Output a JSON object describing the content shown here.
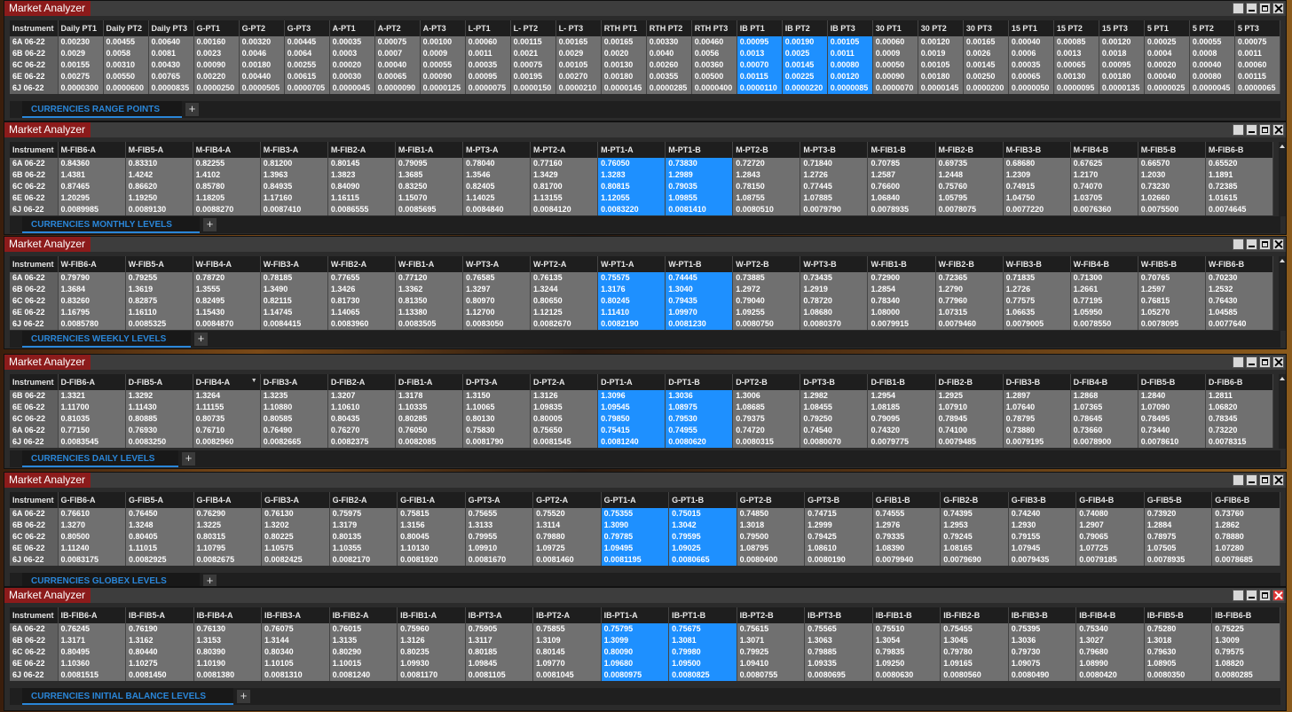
{
  "panels": [
    {
      "title": "Market Analyzer",
      "tab": "CURRENCIES RANGE POINTS",
      "plus": "+",
      "columns": [
        "Instrument",
        "Daily PT1",
        "Daily PT2",
        "Daily PT3",
        "G-PT1",
        "G-PT2",
        "G-PT3",
        "A-PT1",
        "A-PT2",
        "A-PT3",
        "L-PT1",
        "L- PT2",
        "L- PT3",
        "RTH PT1",
        "RTH PT2",
        "RTH PT3",
        "IB PT1",
        "IB PT2",
        "IB PT3",
        "30 PT1",
        "30 PT2",
        "30 PT3",
        "15 PT1",
        "15 PT2",
        "15 PT3",
        "5 PT1",
        "5 PT2",
        "5 PT3"
      ],
      "highlight": [
        16,
        17,
        18
      ],
      "rows": [
        [
          "6A 06-22",
          "0.00230",
          "0.00455",
          "0.00640",
          "0.00160",
          "0.00320",
          "0.00445",
          "0.00035",
          "0.00075",
          "0.00100",
          "0.00060",
          "0.00115",
          "0.00165",
          "0.00165",
          "0.00330",
          "0.00460",
          "0.00095",
          "0.00190",
          "0.00105",
          "0.00060",
          "0.00120",
          "0.00165",
          "0.00040",
          "0.00085",
          "0.00120",
          "0.00025",
          "0.00055",
          "0.00075"
        ],
        [
          "6B 06-22",
          "0.0029",
          "0.0058",
          "0.0081",
          "0.0023",
          "0.0046",
          "0.0064",
          "0.0003",
          "0.0007",
          "0.0009",
          "0.0011",
          "0.0021",
          "0.0029",
          "0.0020",
          "0.0040",
          "0.0056",
          "0.0013",
          "0.0025",
          "0.0011",
          "0.0009",
          "0.0019",
          "0.0026",
          "0.0006",
          "0.0013",
          "0.0018",
          "0.0004",
          "0.0008",
          "0.0011"
        ],
        [
          "6C 06-22",
          "0.00155",
          "0.00310",
          "0.00430",
          "0.00090",
          "0.00180",
          "0.00255",
          "0.00020",
          "0.00040",
          "0.00055",
          "0.00035",
          "0.00075",
          "0.00105",
          "0.00130",
          "0.00260",
          "0.00360",
          "0.00070",
          "0.00145",
          "0.00080",
          "0.00050",
          "0.00105",
          "0.00145",
          "0.00035",
          "0.00065",
          "0.00095",
          "0.00020",
          "0.00040",
          "0.00060"
        ],
        [
          "6E 06-22",
          "0.00275",
          "0.00550",
          "0.00765",
          "0.00220",
          "0.00440",
          "0.00615",
          "0.00030",
          "0.00065",
          "0.00090",
          "0.00095",
          "0.00195",
          "0.00270",
          "0.00180",
          "0.00355",
          "0.00500",
          "0.00115",
          "0.00225",
          "0.00120",
          "0.00090",
          "0.00180",
          "0.00250",
          "0.00065",
          "0.00130",
          "0.00180",
          "0.00040",
          "0.00080",
          "0.00115"
        ],
        [
          "6J 06-22",
          "0.0000300",
          "0.0000600",
          "0.0000835",
          "0.0000250",
          "0.0000505",
          "0.0000705",
          "0.0000045",
          "0.0000090",
          "0.0000125",
          "0.0000075",
          "0.0000150",
          "0.0000210",
          "0.0000145",
          "0.0000285",
          "0.0000400",
          "0.0000110",
          "0.0000220",
          "0.0000085",
          "0.0000070",
          "0.0000145",
          "0.0000200",
          "0.0000050",
          "0.0000095",
          "0.0000135",
          "0.0000025",
          "0.0000045",
          "0.0000065"
        ]
      ]
    },
    {
      "title": "Market Analyzer",
      "tab": "CURRENCIES MONTHLY LEVELS",
      "plus": "+",
      "columns": [
        "Instrument",
        "M-FIB6-A",
        "M-FIB5-A",
        "M-FIB4-A",
        "M-FIB3-A",
        "M-FIB2-A",
        "M-FIB1-A",
        "M-PT3-A",
        "M-PT2-A",
        "M-PT1-A",
        "M-PT1-B",
        "M-PT2-B",
        "M-PT3-B",
        "M-FIB1-B",
        "M-FIB2-B",
        "M-FIB3-B",
        "M-FIB4-B",
        "M-FIB5-B",
        "M-FIB6-B"
      ],
      "highlight": [
        9,
        10
      ],
      "rows": [
        [
          "6A 06-22",
          "0.84360",
          "0.83310",
          "0.82255",
          "0.81200",
          "0.80145",
          "0.79095",
          "0.78040",
          "0.77160",
          "0.76050",
          "0.73830",
          "0.72720",
          "0.71840",
          "0.70785",
          "0.69735",
          "0.68680",
          "0.67625",
          "0.66570",
          "0.65520"
        ],
        [
          "6B 06-22",
          "1.4381",
          "1.4242",
          "1.4102",
          "1.3963",
          "1.3823",
          "1.3685",
          "1.3546",
          "1.3429",
          "1.3283",
          "1.2989",
          "1.2843",
          "1.2726",
          "1.2587",
          "1.2448",
          "1.2309",
          "1.2170",
          "1.2030",
          "1.1891"
        ],
        [
          "6C 06-22",
          "0.87465",
          "0.86620",
          "0.85780",
          "0.84935",
          "0.84090",
          "0.83250",
          "0.82405",
          "0.81700",
          "0.80815",
          "0.79035",
          "0.78150",
          "0.77445",
          "0.76600",
          "0.75760",
          "0.74915",
          "0.74070",
          "0.73230",
          "0.72385"
        ],
        [
          "6E 06-22",
          "1.20295",
          "1.19250",
          "1.18205",
          "1.17160",
          "1.16115",
          "1.15070",
          "1.14025",
          "1.13155",
          "1.12055",
          "1.09855",
          "1.08755",
          "1.07885",
          "1.06840",
          "1.05795",
          "1.04750",
          "1.03705",
          "1.02660",
          "1.01615"
        ],
        [
          "6J 06-22",
          "0.0089985",
          "0.0089130",
          "0.0088270",
          "0.0087410",
          "0.0086555",
          "0.0085695",
          "0.0084840",
          "0.0084120",
          "0.0083220",
          "0.0081410",
          "0.0080510",
          "0.0079790",
          "0.0078935",
          "0.0078075",
          "0.0077220",
          "0.0076360",
          "0.0075500",
          "0.0074645"
        ]
      ]
    },
    {
      "title": "Market Analyzer",
      "tab": "CURRENCIES WEEKLY LEVELS",
      "plus": "+",
      "columns": [
        "Instrument",
        "W-FIB6-A",
        "W-FIB5-A",
        "W-FIB4-A",
        "W-FIB3-A",
        "W-FIB2-A",
        "W-FIB1-A",
        "W-PT3-A",
        "W-PT2-A",
        "W-PT1-A",
        "W-PT1-B",
        "W-PT2-B",
        "W-PT3-B",
        "W-FIB1-B",
        "W-FIB2-B",
        "W-FIB3-B",
        "W-FIB4-B",
        "W-FIB5-B",
        "W-FIB6-B"
      ],
      "highlight": [
        9,
        10
      ],
      "rows": [
        [
          "6A 06-22",
          "0.79790",
          "0.79255",
          "0.78720",
          "0.78185",
          "0.77655",
          "0.77120",
          "0.76585",
          "0.76135",
          "0.75575",
          "0.74445",
          "0.73885",
          "0.73435",
          "0.72900",
          "0.72365",
          "0.71835",
          "0.71300",
          "0.70765",
          "0.70230"
        ],
        [
          "6B 06-22",
          "1.3684",
          "1.3619",
          "1.3555",
          "1.3490",
          "1.3426",
          "1.3362",
          "1.3297",
          "1.3244",
          "1.3176",
          "1.3040",
          "1.2972",
          "1.2919",
          "1.2854",
          "1.2790",
          "1.2726",
          "1.2661",
          "1.2597",
          "1.2532"
        ],
        [
          "6C 06-22",
          "0.83260",
          "0.82875",
          "0.82495",
          "0.82115",
          "0.81730",
          "0.81350",
          "0.80970",
          "0.80650",
          "0.80245",
          "0.79435",
          "0.79040",
          "0.78720",
          "0.78340",
          "0.77960",
          "0.77575",
          "0.77195",
          "0.76815",
          "0.76430"
        ],
        [
          "6E 06-22",
          "1.16795",
          "1.16110",
          "1.15430",
          "1.14745",
          "1.14065",
          "1.13380",
          "1.12700",
          "1.12125",
          "1.11410",
          "1.09970",
          "1.09255",
          "1.08680",
          "1.08000",
          "1.07315",
          "1.06635",
          "1.05950",
          "1.05270",
          "1.04585"
        ],
        [
          "6J 06-22",
          "0.0085780",
          "0.0085325",
          "0.0084870",
          "0.0084415",
          "0.0083960",
          "0.0083505",
          "0.0083050",
          "0.0082670",
          "0.0082190",
          "0.0081230",
          "0.0080750",
          "0.0080370",
          "0.0079915",
          "0.0079460",
          "0.0079005",
          "0.0078550",
          "0.0078095",
          "0.0077640"
        ]
      ]
    },
    {
      "title": "Market Analyzer",
      "tab": "CURRENCIES DAILY LEVELS",
      "plus": "+",
      "columns": [
        "Instrument",
        "D-FIB6-A",
        "D-FIB5-A",
        "D-FIB4-A",
        "D-FIB3-A",
        "D-FIB2-A",
        "D-FIB1-A",
        "D-PT3-A",
        "D-PT2-A",
        "D-PT1-A",
        "D-PT1-B",
        "D-PT2-B",
        "D-PT3-B",
        "D-FIB1-B",
        "D-FIB2-B",
        "D-FIB3-B",
        "D-FIB4-B",
        "D-FIB5-B",
        "D-FIB6-B"
      ],
      "highlight": [
        9,
        10
      ],
      "sort_arrow": "▼",
      "rows": [
        [
          "6B 06-22",
          "1.3321",
          "1.3292",
          "1.3264",
          "1.3235",
          "1.3207",
          "1.3178",
          "1.3150",
          "1.3126",
          "1.3096",
          "1.3036",
          "1.3006",
          "1.2982",
          "1.2954",
          "1.2925",
          "1.2897",
          "1.2868",
          "1.2840",
          "1.2811"
        ],
        [
          "6E 06-22",
          "1.11700",
          "1.11430",
          "1.11155",
          "1.10880",
          "1.10610",
          "1.10335",
          "1.10065",
          "1.09835",
          "1.09545",
          "1.08975",
          "1.08685",
          "1.08455",
          "1.08185",
          "1.07910",
          "1.07640",
          "1.07365",
          "1.07090",
          "1.06820"
        ],
        [
          "6C 06-22",
          "0.81035",
          "0.80885",
          "0.80735",
          "0.80585",
          "0.80435",
          "0.80285",
          "0.80130",
          "0.80005",
          "0.79850",
          "0.79530",
          "0.79375",
          "0.79250",
          "0.79095",
          "0.78945",
          "0.78795",
          "0.78645",
          "0.78495",
          "0.78345"
        ],
        [
          "6A 06-22",
          "0.77150",
          "0.76930",
          "0.76710",
          "0.76490",
          "0.76270",
          "0.76050",
          "0.75830",
          "0.75650",
          "0.75415",
          "0.74955",
          "0.74720",
          "0.74540",
          "0.74320",
          "0.74100",
          "0.73880",
          "0.73660",
          "0.73440",
          "0.73220"
        ],
        [
          "6J 06-22",
          "0.0083545",
          "0.0083250",
          "0.0082960",
          "0.0082665",
          "0.0082375",
          "0.0082085",
          "0.0081790",
          "0.0081545",
          "0.0081240",
          "0.0080620",
          "0.0080315",
          "0.0080070",
          "0.0079775",
          "0.0079485",
          "0.0079195",
          "0.0078900",
          "0.0078610",
          "0.0078315"
        ]
      ]
    },
    {
      "title": "Market Analyzer",
      "tab": "CURRENCIES GLOBEX LEVELS",
      "plus": "+",
      "columns": [
        "Instrument",
        "G-FIB6-A",
        "G-FIB5-A",
        "G-FIB4-A",
        "G-FIB3-A",
        "G-FIB2-A",
        "G-FIB1-A",
        "G-PT3-A",
        "G-PT2-A",
        "G-PT1-A",
        "G-PT1-B",
        "G-PT2-B",
        "G-PT3-B",
        "G-FIB1-B",
        "G-FIB2-B",
        "G-FIB3-B",
        "G-FIB4-B",
        "G-FIB5-B",
        "G-FIB6-B"
      ],
      "highlight": [
        9,
        10
      ],
      "rows": [
        [
          "6A 06-22",
          "0.76610",
          "0.76450",
          "0.76290",
          "0.76130",
          "0.75975",
          "0.75815",
          "0.75655",
          "0.75520",
          "0.75355",
          "0.75015",
          "0.74850",
          "0.74715",
          "0.74555",
          "0.74395",
          "0.74240",
          "0.74080",
          "0.73920",
          "0.73760"
        ],
        [
          "6B 06-22",
          "1.3270",
          "1.3248",
          "1.3225",
          "1.3202",
          "1.3179",
          "1.3156",
          "1.3133",
          "1.3114",
          "1.3090",
          "1.3042",
          "1.3018",
          "1.2999",
          "1.2976",
          "1.2953",
          "1.2930",
          "1.2907",
          "1.2884",
          "1.2862"
        ],
        [
          "6C 06-22",
          "0.80500",
          "0.80405",
          "0.80315",
          "0.80225",
          "0.80135",
          "0.80045",
          "0.79955",
          "0.79880",
          "0.79785",
          "0.79595",
          "0.79500",
          "0.79425",
          "0.79335",
          "0.79245",
          "0.79155",
          "0.79065",
          "0.78975",
          "0.78880"
        ],
        [
          "6E 06-22",
          "1.11240",
          "1.11015",
          "1.10795",
          "1.10575",
          "1.10355",
          "1.10130",
          "1.09910",
          "1.09725",
          "1.09495",
          "1.09025",
          "1.08795",
          "1.08610",
          "1.08390",
          "1.08165",
          "1.07945",
          "1.07725",
          "1.07505",
          "1.07280"
        ],
        [
          "6J 06-22",
          "0.0083175",
          "0.0082925",
          "0.0082675",
          "0.0082425",
          "0.0082170",
          "0.0081920",
          "0.0081670",
          "0.0081460",
          "0.0081195",
          "0.0080665",
          "0.0080400",
          "0.0080190",
          "0.0079940",
          "0.0079690",
          "0.0079435",
          "0.0079185",
          "0.0078935",
          "0.0078685"
        ]
      ]
    },
    {
      "title": "Market Analyzer",
      "tab": "CURRENCIES INITIAL BALANCE LEVELS",
      "plus": "+",
      "columns": [
        "Instrument",
        "IB-FIB6-A",
        "IB-FIB5-A",
        "IB-FIB4-A",
        "IB-FIB3-A",
        "IB-FIB2-A",
        "IB-FIB1-A",
        "IB-PT3-A",
        "IB-PT2-A",
        "IB-PT1-A",
        "IB-PT1-B",
        "IB-PT2-B",
        "IB-PT3-B",
        "IB-FIB1-B",
        "IB-FIB2-B",
        "IB-FIB3-B",
        "IB-FIB4-B",
        "IB-FIB5-B",
        "IB-FIB6-B"
      ],
      "highlight": [
        9,
        10
      ],
      "rows": [
        [
          "6A 06-22",
          "0.76245",
          "0.76190",
          "0.76130",
          "0.76075",
          "0.76015",
          "0.75960",
          "0.75905",
          "0.75855",
          "0.75795",
          "0.75675",
          "0.75615",
          "0.75565",
          "0.75510",
          "0.75455",
          "0.75395",
          "0.75340",
          "0.75280",
          "0.75225"
        ],
        [
          "6B 06-22",
          "1.3171",
          "1.3162",
          "1.3153",
          "1.3144",
          "1.3135",
          "1.3126",
          "1.3117",
          "1.3109",
          "1.3099",
          "1.3081",
          "1.3071",
          "1.3063",
          "1.3054",
          "1.3045",
          "1.3036",
          "1.3027",
          "1.3018",
          "1.3009"
        ],
        [
          "6C 06-22",
          "0.80495",
          "0.80440",
          "0.80390",
          "0.80340",
          "0.80290",
          "0.80235",
          "0.80185",
          "0.80145",
          "0.80090",
          "0.79980",
          "0.79925",
          "0.79885",
          "0.79835",
          "0.79780",
          "0.79730",
          "0.79680",
          "0.79630",
          "0.79575"
        ],
        [
          "6E 06-22",
          "1.10360",
          "1.10275",
          "1.10190",
          "1.10105",
          "1.10015",
          "1.09930",
          "1.09845",
          "1.09770",
          "1.09680",
          "1.09500",
          "1.09410",
          "1.09335",
          "1.09250",
          "1.09165",
          "1.09075",
          "1.08990",
          "1.08905",
          "1.08820"
        ],
        [
          "6J 06-22",
          "0.0081515",
          "0.0081450",
          "0.0081380",
          "0.0081310",
          "0.0081240",
          "0.0081170",
          "0.0081105",
          "0.0081045",
          "0.0080975",
          "0.0080825",
          "0.0080755",
          "0.0080695",
          "0.0080630",
          "0.0080560",
          "0.0080490",
          "0.0080420",
          "0.0080350",
          "0.0080285"
        ]
      ]
    }
  ]
}
